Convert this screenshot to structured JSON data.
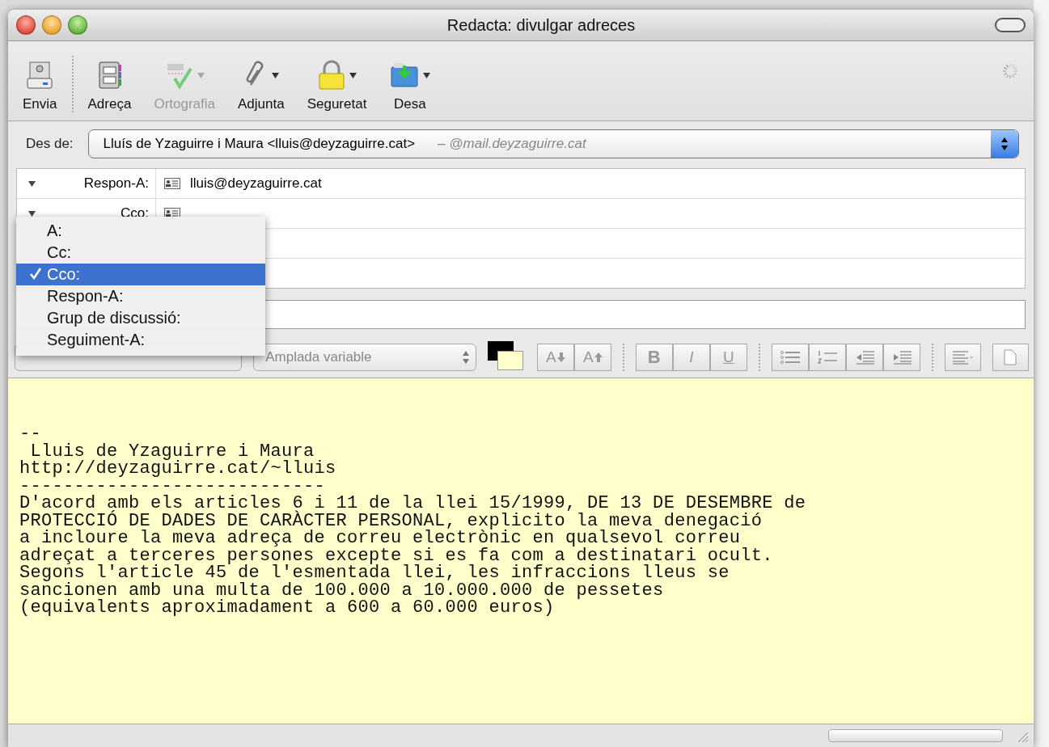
{
  "window": {
    "title": "Redacta: divulgar adreces"
  },
  "toolbar": [
    {
      "kind": "send",
      "label": "Envia",
      "disabled": false,
      "has_menu": false
    },
    {
      "kind": "address",
      "label": "Adreça",
      "disabled": false,
      "has_menu": false
    },
    {
      "kind": "spelling",
      "label": "Ortografia",
      "disabled": true,
      "has_menu": true
    },
    {
      "kind": "attach",
      "label": "Adjunta",
      "disabled": false,
      "has_menu": true
    },
    {
      "kind": "security",
      "label": "Seguretat",
      "disabled": false,
      "has_menu": true
    },
    {
      "kind": "save",
      "label": "Desa",
      "disabled": false,
      "has_menu": true
    }
  ],
  "from": {
    "label": "Des de:",
    "value": "Lluís de Yzaguirre i Maura <lluis@deyzaguirre.cat>",
    "account": "– @mail.deyzaguirre.cat"
  },
  "address_rows": [
    {
      "label": "Respon-A:",
      "value": "lluis@deyzaguirre.cat"
    },
    {
      "label": "Cco:"
    }
  ],
  "recipient_menu": [
    {
      "label": "A:",
      "selected": false
    },
    {
      "label": "Cc:",
      "selected": false
    },
    {
      "label": "Cco:",
      "selected": true
    },
    {
      "label": "Respon-A:",
      "selected": false
    },
    {
      "label": "Grup de discussió:",
      "selected": false
    },
    {
      "label": "Seguiment-A:",
      "selected": false
    }
  ],
  "format_bar": {
    "width_font": "Amplada variable",
    "size_buttons": [
      "A",
      "A"
    ],
    "style_buttons": [
      "B",
      "I",
      "U"
    ]
  },
  "status": {
    "progress": {
      "level": 0
    }
  },
  "body": {
    "text": "--\n Lluis de Yzaguirre i Maura\nhttp://deyzaguirre.cat/~lluis\n----------------------------\nD'acord amb els articles 6 i 11 de la llei 15/1999, DE 13 DE DESEMBRE de\nPROTECCIÓ DE DADES DE CARÀCTER PERSONAL, explicito la meva denegació\na incloure la meva adreça de correu electrònic en qualsevol correu\nadreçat a terceres persones excepte si es fa com a destinatari ocult.\nSegons l'article 45 de l'esmentada llei, les infraccions lleus se\nsancionen amb una multa de 100.000 a 10.000.000 de pessetes\n(equivalents aproximadament a 600 a 60.000 euros)"
  }
}
